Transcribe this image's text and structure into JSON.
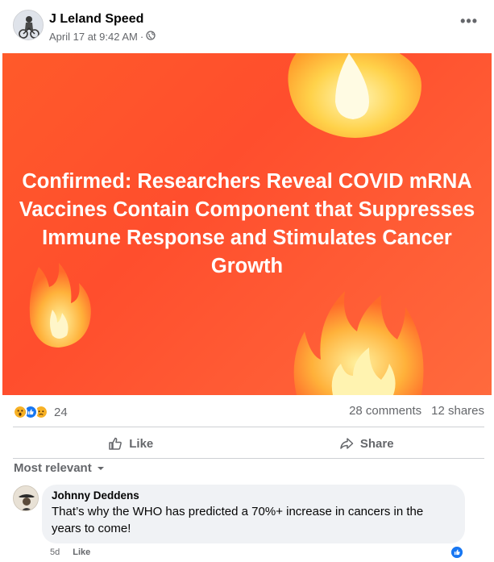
{
  "post": {
    "author": "J Leland Speed",
    "timestamp": "April 17 at 9:42 AM",
    "meta_separator": "·",
    "privacy_icon": "globe-icon",
    "more_label": "•••"
  },
  "banner": {
    "headline": "Confirmed: Researchers Reveal COVID mRNA Vaccines Contain Component that Suppresses Immune Response and Stimulates Cancer Growth",
    "background_color": "#ff5a2a"
  },
  "stats": {
    "reaction_icons": [
      "wow-reaction-icon",
      "like-reaction-icon",
      "sad-reaction-icon"
    ],
    "reaction_count": "24",
    "comments": "28 comments",
    "shares": "12 shares"
  },
  "actions": {
    "like_label": "Like",
    "share_label": "Share"
  },
  "comments_section": {
    "sort_label": "Most relevant",
    "comments": [
      {
        "author": "Johnny Deddens",
        "text": "That’s why the WHO has predicted a 70%+ increase in cancers in the years to come!",
        "age": "5d",
        "like_label": "Like"
      }
    ]
  },
  "colors": {
    "accent": "#1877f2",
    "muted_text": "#65676b",
    "like_blue": "#1877f2",
    "wow_yellow": "#f7b125",
    "sad_yellow": "#f7b125"
  }
}
